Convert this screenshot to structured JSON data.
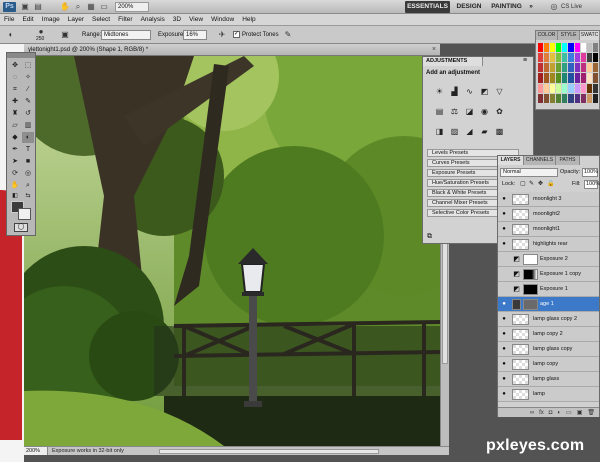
{
  "app": {
    "logo": "Ps",
    "zoom": "200%",
    "workspaces": [
      "ESSENTIALS",
      "DESIGN",
      "PAINTING",
      "»"
    ],
    "cs_live": "CS Live"
  },
  "menu": [
    "File",
    "Edit",
    "Image",
    "Layer",
    "Select",
    "Filter",
    "Analysis",
    "3D",
    "View",
    "Window",
    "Help"
  ],
  "options": {
    "brush_size": "250",
    "range_label": "Range:",
    "range_value": "Midtones",
    "exposure_label": "Exposure:",
    "exposure_value": "16%",
    "protect_label": "Protect Tones",
    "protect_checked": "✓"
  },
  "document": {
    "title": "ylettonight1.psd @ 200% (Shape 1, RGB/8) *",
    "zoom": "200%",
    "status": "Exposure works in 32-bit only"
  },
  "swatch_tabs": [
    "COLOR",
    "SWATC",
    "STYLE"
  ],
  "swatches": [
    "#ff0000",
    "#ff7f00",
    "#ffff00",
    "#00ff00",
    "#00ffff",
    "#0000ff",
    "#ff00ff",
    "#ffffff",
    "#c0c0c0",
    "#808080",
    "#e03c3c",
    "#e07c3c",
    "#e0c03c",
    "#7cc03c",
    "#3cc0a0",
    "#3c7ce0",
    "#a03ce0",
    "#e03ca0",
    "#404040",
    "#000000",
    "#c03030",
    "#c06a30",
    "#c0a030",
    "#6aa030",
    "#30a080",
    "#3060c0",
    "#8030c0",
    "#c03080",
    "#ffcc99",
    "#996633",
    "#a02020",
    "#a05820",
    "#a08820",
    "#589020",
    "#208870",
    "#2050a0",
    "#6a20a0",
    "#a02070",
    "#ffe0c0",
    "#805030",
    "#ff9999",
    "#ffcc99",
    "#ffff99",
    "#ccff99",
    "#99ffcc",
    "#99ccff",
    "#cc99ff",
    "#ff99cc",
    "#663300",
    "#333333",
    "#803030",
    "#805030",
    "#808030",
    "#508030",
    "#308060",
    "#304080",
    "#503080",
    "#803060",
    "#cc9966",
    "#202020"
  ],
  "adjustments": {
    "tab": "ADJUSTMENTS",
    "heading": "Add an adjustment",
    "presets": [
      "Levels Presets",
      "Curves Presets",
      "Exposure Presets",
      "Hue/Saturation Presets",
      "Black & White Presets",
      "Channel Mixer Presets",
      "Selective Color Presets"
    ]
  },
  "layers": {
    "tabs": [
      "LAYERS",
      "CHANNELS",
      "PATHS"
    ],
    "blend_mode": "Normal",
    "opacity_label": "Opacity:",
    "opacity_value": "100%",
    "lock_label": "Lock:",
    "fill_label": "Fill:",
    "fill_value": "100%",
    "items": [
      {
        "name": "moonlight 3"
      },
      {
        "name": "moonlight2"
      },
      {
        "name": "moonlight1"
      },
      {
        "name": "highlights rear"
      },
      {
        "name": "Exposure 2"
      },
      {
        "name": "Exposure 1 copy"
      },
      {
        "name": "Exposure 1"
      },
      {
        "name": "age 1"
      },
      {
        "name": "lamp glass copy 2"
      },
      {
        "name": "lamp copy 2"
      },
      {
        "name": "lamp glass copy"
      },
      {
        "name": "lamp copy"
      },
      {
        "name": "lamp glass"
      },
      {
        "name": "lamp"
      }
    ]
  },
  "watermark": "pxleyes.com"
}
